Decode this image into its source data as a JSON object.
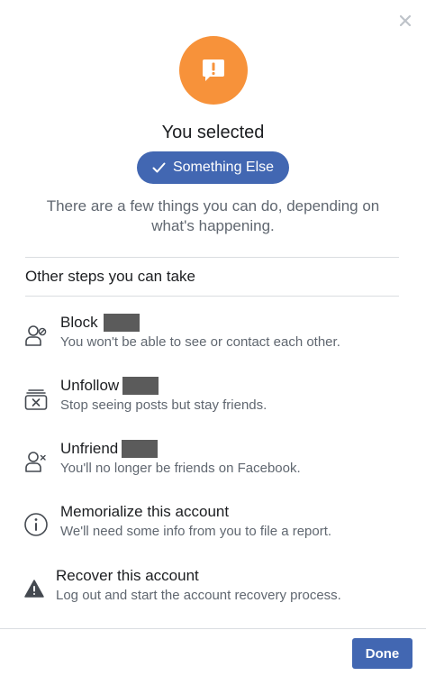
{
  "header": {
    "icon": "alert-speech-bubble-icon",
    "accent_color": "#f7923a",
    "title": "You selected",
    "selected_label": "Something Else",
    "description": "There are a few things you can do, depending on what's happening."
  },
  "steps": {
    "heading": "Other steps you can take",
    "options": [
      {
        "icon": "block-user-icon",
        "title": "Block",
        "subtitle": "You won't be able to see or contact each other."
      },
      {
        "icon": "unfollow-icon",
        "title": "Unfollow",
        "subtitle": "Stop seeing posts but stay friends."
      },
      {
        "icon": "unfriend-icon",
        "title": "Unfriend",
        "subtitle": "You'll no longer be friends on Facebook."
      },
      {
        "icon": "info-icon",
        "title": "Memorialize this account",
        "subtitle": "We'll need some info from you to file a report."
      },
      {
        "icon": "warning-icon",
        "title": "Recover this account",
        "subtitle": "Log out and start the account recovery process."
      }
    ]
  },
  "footer": {
    "done_label": "Done",
    "button_color": "#4267b2"
  }
}
